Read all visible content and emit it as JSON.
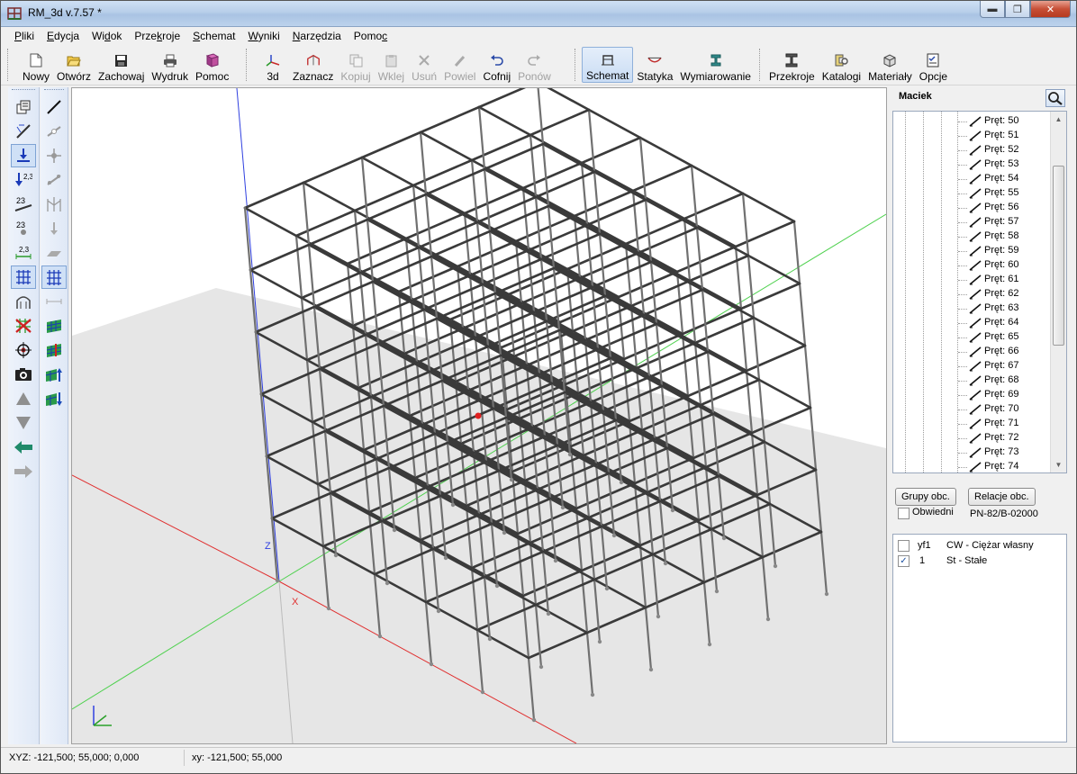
{
  "window": {
    "title": "RM_3d v.7.57 *"
  },
  "menu": [
    {
      "pre": "",
      "u": "P",
      "post": "liki"
    },
    {
      "pre": "",
      "u": "E",
      "post": "dycja"
    },
    {
      "pre": "Wi",
      "u": "d",
      "post": "ok"
    },
    {
      "pre": "Prze",
      "u": "k",
      "post": "roje"
    },
    {
      "pre": "",
      "u": "S",
      "post": "chemat"
    },
    {
      "pre": "",
      "u": "W",
      "post": "yniki"
    },
    {
      "pre": "",
      "u": "N",
      "post": "arzędzia"
    },
    {
      "pre": "Pomo",
      "u": "c",
      "post": ""
    }
  ],
  "toolbar": {
    "nowy": "Nowy",
    "otworz": "Otwórz",
    "zachowaj": "Zachowaj",
    "wydruk": "Wydruk",
    "pomoc": "Pomoc",
    "view3d": "3d",
    "zaznacz": "Zaznacz",
    "kopiuj": "Kopiuj",
    "wklej": "Wklej",
    "usun": "Usuń",
    "powiel": "Powiel",
    "cofnij": "Cofnij",
    "ponow": "Ponów",
    "schemat": "Schemat",
    "statyka": "Statyka",
    "wymiarowanie": "Wymiarowanie",
    "przekroje": "Przekroje",
    "katalogi": "Katalogi",
    "materialy": "Materiały",
    "opcje": "Opcje"
  },
  "palette": {
    "label_23a": "2,3",
    "label_23b": "23",
    "label_23c": "23",
    "label_23d": "2,3"
  },
  "viewport": {
    "axis_x": "X",
    "axis_z": "Z"
  },
  "panel": {
    "title": "Maciek",
    "tree_items": [
      "Pręt: 50",
      "Pręt: 51",
      "Pręt: 52",
      "Pręt: 53",
      "Pręt: 54",
      "Pręt: 55",
      "Pręt: 56",
      "Pręt: 57",
      "Pręt: 58",
      "Pręt: 59",
      "Pręt: 60",
      "Pręt: 61",
      "Pręt: 62",
      "Pręt: 63",
      "Pręt: 64",
      "Pręt: 65",
      "Pręt: 66",
      "Pręt: 67",
      "Pręt: 68",
      "Pręt: 69",
      "Pręt: 70",
      "Pręt: 71",
      "Pręt: 72",
      "Pręt: 73",
      "Pręt: 74"
    ],
    "btn_grupy": "Grupy obc.",
    "btn_relacje": "Relacje obc.",
    "obwiedni": "Obwiedni",
    "norm": "PN-82/B-02000",
    "loads": [
      {
        "code": "yf1",
        "name": "CW - Ciężar własny",
        "checked": false
      },
      {
        "code": "1",
        "name": "St - Stałe",
        "checked": true
      }
    ]
  },
  "status": {
    "xyz": "XYZ: -121,500; 55,000; 0,000",
    "xy": "xy: -121,500; 55,000"
  }
}
